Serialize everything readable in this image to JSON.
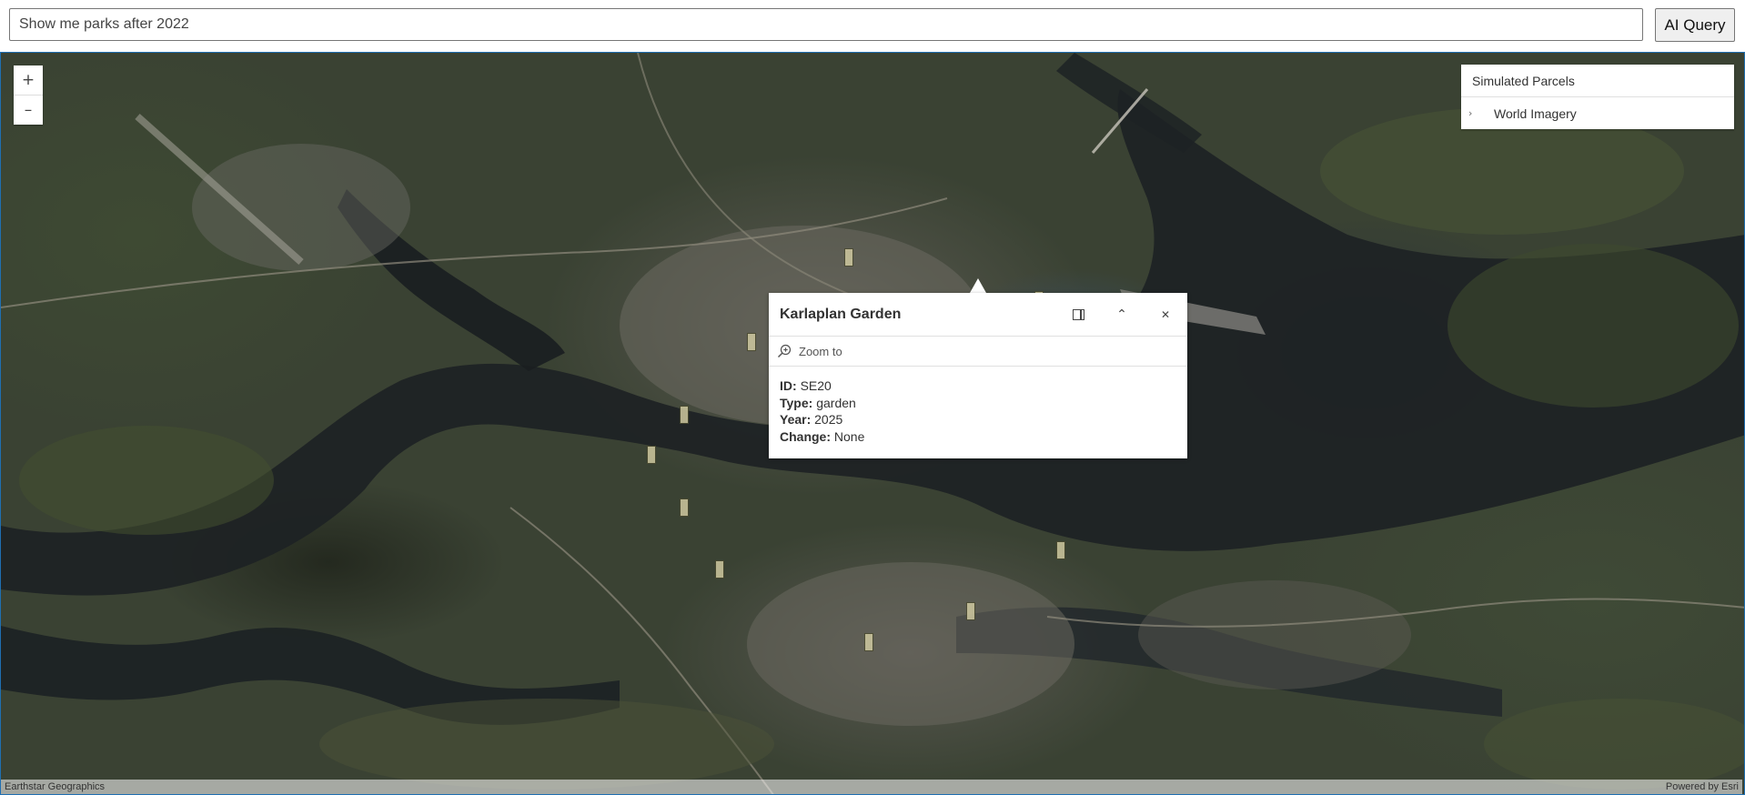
{
  "query": {
    "value": "Show me parks after 2022",
    "button_label": "AI Query"
  },
  "map": {
    "zoom_in_label": "+",
    "zoom_out_label": "–",
    "layers": [
      {
        "label": "Simulated Parcels",
        "expandable": false
      },
      {
        "label": "World Imagery",
        "expandable": true,
        "chevron": "›"
      }
    ],
    "attribution_left": "Earthstar Geographics",
    "attribution_right": "Powered by Esri"
  },
  "popup": {
    "title": "Karlaplan Garden",
    "actions": [
      "dock-icon",
      "collapse-icon",
      "close-icon"
    ],
    "collapse_glyph": "⌃",
    "close_glyph": "✕",
    "zoom_to_label": "Zoom to",
    "fields": [
      {
        "label": "ID:",
        "value": "SE20"
      },
      {
        "label": "Type:",
        "value": "garden"
      },
      {
        "label": "Year:",
        "value": "2025"
      },
      {
        "label": "Change:",
        "value": "None"
      }
    ]
  },
  "colors": {
    "selection": "#22d8e0",
    "map_border": "#1f6fb2"
  }
}
